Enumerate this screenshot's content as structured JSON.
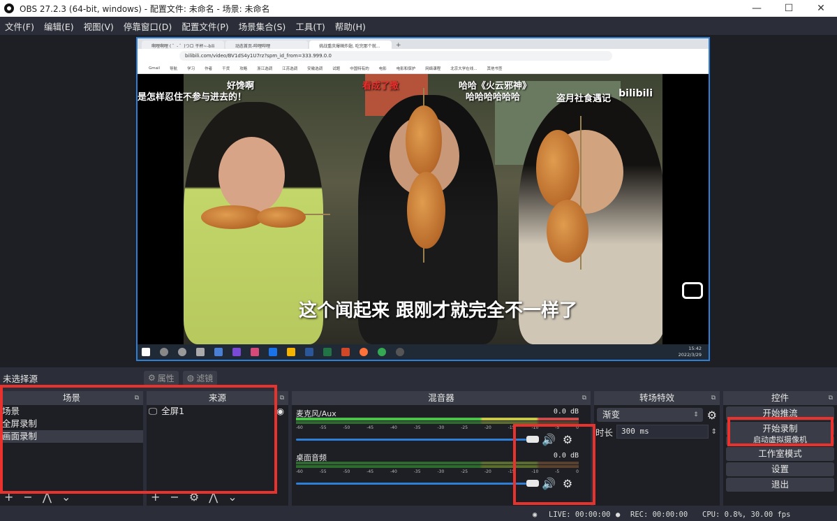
{
  "window": {
    "title": "OBS 27.2.3 (64-bit, windows) - 配置文件: 未命名 - 场景: 未命名",
    "minimize": "—",
    "maximize": "☐",
    "close": "✕"
  },
  "menu": [
    "文件(F)",
    "编辑(E)",
    "视图(V)",
    "停靠窗口(D)",
    "配置文件(P)",
    "场景集合(S)",
    "工具(T)",
    "帮助(H)"
  ],
  "preview": {
    "browser_tabs": [
      "啊哩啊哩 ( ゜- ゜)つロ 干杯~-bili",
      "动态首页-哔哩哔哩",
      "挑战重庆爆辣炸翅, 吃完那个就..."
    ],
    "url": "bilibili.com/video/BV1dS4y1U7rz?spm_id_from=333.999.0.0",
    "bookmarks": [
      "Gmail",
      "导航",
      "学习",
      "作者",
      "干货",
      "攻略",
      "浙江选调",
      "江苏选调",
      "安徽选调",
      "试题",
      "中国特有的",
      "电影",
      "电影和保护",
      "网络课程",
      "北京大学在线...",
      "其他书签"
    ],
    "subtitle_top_left_1": "好馋啊",
    "subtitle_top_left_2": "是怎样忍住不参与进去的！",
    "subtitle_top_mid": "看成了撒",
    "subtitle_top_right_1": "哈哈《火云邪神》",
    "subtitle_top_right_2": "哈哈哈哈哈哈",
    "channel_tag": "盗月社食遇记",
    "logo": "bilibili",
    "subtitle_main": "这个闻起来 跟刚才就完全不一样了",
    "clock_time": "15:42",
    "clock_date": "2022/3/29"
  },
  "source_bar": {
    "no_source": "未选择源",
    "properties": "属性",
    "filters": "滤镜"
  },
  "scenes": {
    "header": "场景",
    "items": [
      "场景",
      "全屏录制",
      "画面录制"
    ],
    "selected_index": 2
  },
  "sources": {
    "header": "来源",
    "items": [
      "全屏1"
    ]
  },
  "mixer": {
    "header": "混音器",
    "channels": [
      {
        "name": "麦克风/Aux",
        "db": "0.0 dB"
      },
      {
        "name": "桌面音频",
        "db": "0.0 dB"
      }
    ],
    "ticks": [
      "-60",
      "-55",
      "-50",
      "-45",
      "-40",
      "-35",
      "-30",
      "-25",
      "-20",
      "-15",
      "-10",
      "-5",
      "0"
    ]
  },
  "transitions": {
    "header": "转场特效",
    "selected": "渐变",
    "duration_label": "时长",
    "duration_value": "300 ms"
  },
  "controls": {
    "header": "控件",
    "buttons": [
      "开始推流",
      "开始录制",
      "启动虚拟摄像机",
      "工作室模式",
      "设置",
      "退出"
    ]
  },
  "status": {
    "live": "LIVE: 00:00:00",
    "rec": "REC: 00:00:00",
    "cpu": "CPU: 0.8%, 30.00 fps"
  },
  "colors": {
    "accent": "#2f7fd6",
    "highlight_box": "#e8322e",
    "panel": "#2b2e38"
  }
}
